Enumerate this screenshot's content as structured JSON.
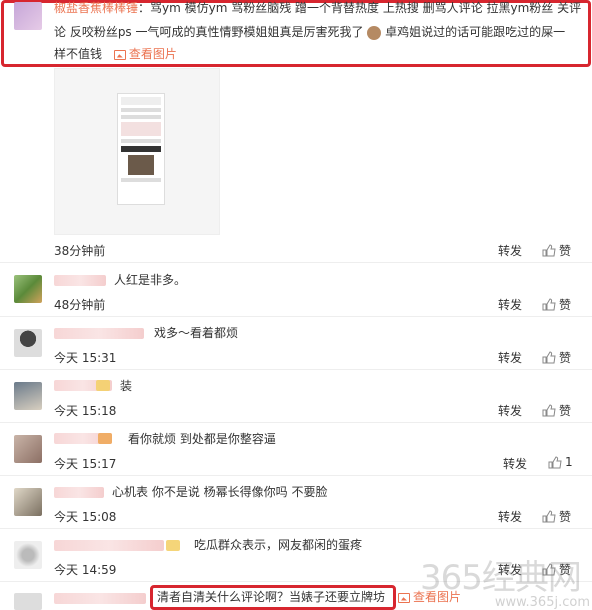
{
  "top_comment": {
    "username": "椒盐香蕉棒棒锤",
    "text_line1": "骂ym 模仿ym 骂粉丝脑残 蹭一个背替热度 上热搜 删骂人评论 拉黑ym粉丝 关评",
    "text_line2": "论 反咬粉丝ps 一气呵成的真性情野模姐姐真是厉害死我了",
    "text_line2b": "卓鸡姐说过的话可能跟吃过的屎一",
    "text_line3": "样不值钱",
    "view_image": "查看图片",
    "time": "38分钟前",
    "forward": "转发",
    "like": "赞"
  },
  "comments": [
    {
      "text": "人红是非多。",
      "time": "48分钟前",
      "forward": "转发",
      "like": "赞"
    },
    {
      "text": "戏多～看着都烦",
      "time": "今天 15:31",
      "forward": "转发",
      "like": "赞"
    },
    {
      "text": "装",
      "time": "今天 15:18",
      "forward": "转发",
      "like": "赞"
    },
    {
      "text": "看你就烦 到处都是你整容逼",
      "time": "今天 15:17",
      "forward": "转发",
      "like": "1"
    },
    {
      "text": "心机表  你不是说 杨幂长得像你吗 不要脸",
      "time": "今天 15:08",
      "forward": "转发",
      "like": "赞"
    },
    {
      "text": "吃瓜群众表示，网友都闲的蛋疼",
      "time": "今天 14:59",
      "forward": "转发",
      "like": "赞"
    },
    {
      "text": "清者自清关什么评论啊？当婊子还要立牌坊",
      "view_image": "查看图片"
    }
  ],
  "watermark": {
    "big": "365经典网",
    "small": "www.365j.com"
  },
  "colors": {
    "highlight": "#d7262f",
    "link": "#eb7350"
  }
}
